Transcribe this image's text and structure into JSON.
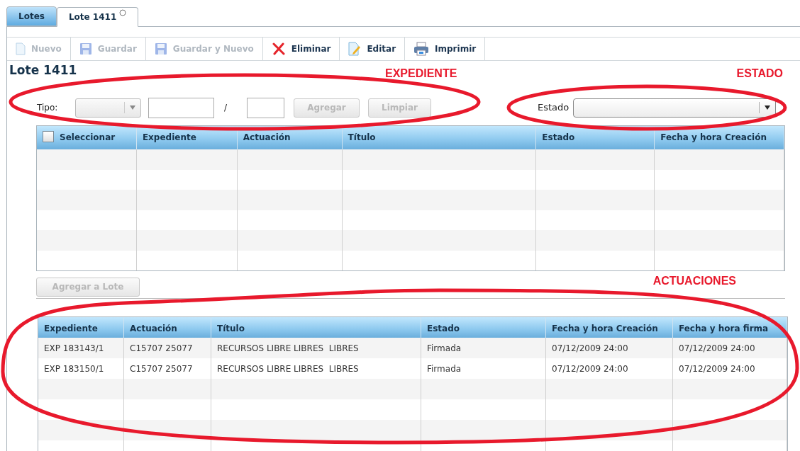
{
  "tabs": [
    {
      "label": "Lotes",
      "selected": false,
      "closable": false
    },
    {
      "label": "Lote 1411",
      "selected": true,
      "closable": true
    }
  ],
  "toolbar": [
    {
      "label": "Nuevo",
      "kind": "page",
      "disabled": true
    },
    {
      "label": "Guardar",
      "kind": "floppy",
      "disabled": true
    },
    {
      "label": "Guardar y Nuevo",
      "kind": "floppy",
      "disabled": true
    },
    {
      "label": "Eliminar",
      "kind": "delete",
      "disabled": false
    },
    {
      "label": "Editar",
      "kind": "edit",
      "disabled": false
    },
    {
      "label": "Imprimir",
      "kind": "print",
      "disabled": false
    }
  ],
  "title": "Lote 1411",
  "annotations": {
    "expediente": "EXPEDIENTE",
    "estado": "ESTADO",
    "actuaciones": "ACTUACIONES"
  },
  "filter": {
    "tipo_label": "Tipo:",
    "separator": "/",
    "buttons": [
      {
        "label": "Agregar",
        "disabled": true
      },
      {
        "label": "Limpiar",
        "disabled": true
      }
    ],
    "estado_label": "Estado"
  },
  "upper_grid": {
    "select_all": {
      "label": "Seleccionar",
      "checked": false
    },
    "columns": [
      "Expediente",
      "Actuación",
      "Título",
      "Estado",
      "Fecha y hora Creación"
    ]
  },
  "add_button": {
    "label": "Agregar a Lote",
    "disabled": true
  },
  "lower_grid": {
    "columns": [
      "Expediente",
      "Actuación",
      "Título",
      "Estado",
      "Fecha y hora Creación",
      "Fecha y hora firma"
    ],
    "rows": [
      [
        "EXP 183143/1",
        "C15707 25077",
        "RECURSOS LIBRE LIBRES  LIBRES",
        "Firmada",
        "07/12/2009 24:00",
        "07/12/2009 24:00"
      ],
      [
        "EXP 183150/1",
        "C15707 25077",
        "RECURSOS LIBRE LIBRES  LIBRES",
        "Firmada",
        "07/12/2009 24:00",
        "07/12/2009 24:00"
      ]
    ]
  }
}
